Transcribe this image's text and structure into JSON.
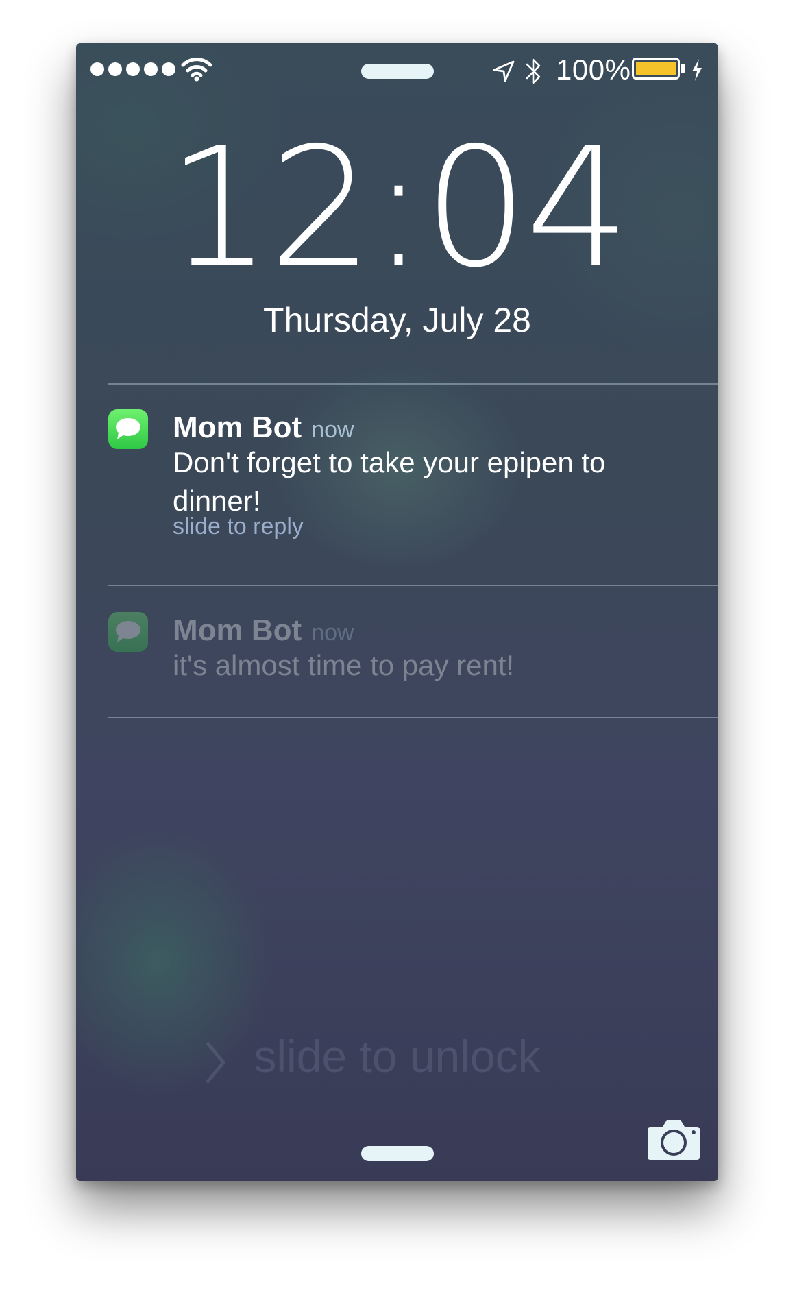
{
  "status_bar": {
    "signal_dots": 5,
    "battery_percent": "100%",
    "battery_color": "#f6c32a",
    "icons": [
      "wifi-icon",
      "location-arrow-icon",
      "bluetooth-icon",
      "battery-icon",
      "charging-bolt-icon"
    ]
  },
  "lock_screen": {
    "time": "12:04",
    "date": "Thursday, July 28"
  },
  "notifications": [
    {
      "app_icon": "messages-icon",
      "sender": "Mom Bot",
      "time": "now",
      "message": "Don't forget to take your epipen to dinner!",
      "action": "slide to reply"
    },
    {
      "app_icon": "messages-icon",
      "sender": "Mom Bot",
      "time": "now",
      "message": "it's almost time to pay rent!"
    }
  ],
  "footer": {
    "unlock_text": "slide to unlock",
    "camera_icon": "camera-icon"
  }
}
